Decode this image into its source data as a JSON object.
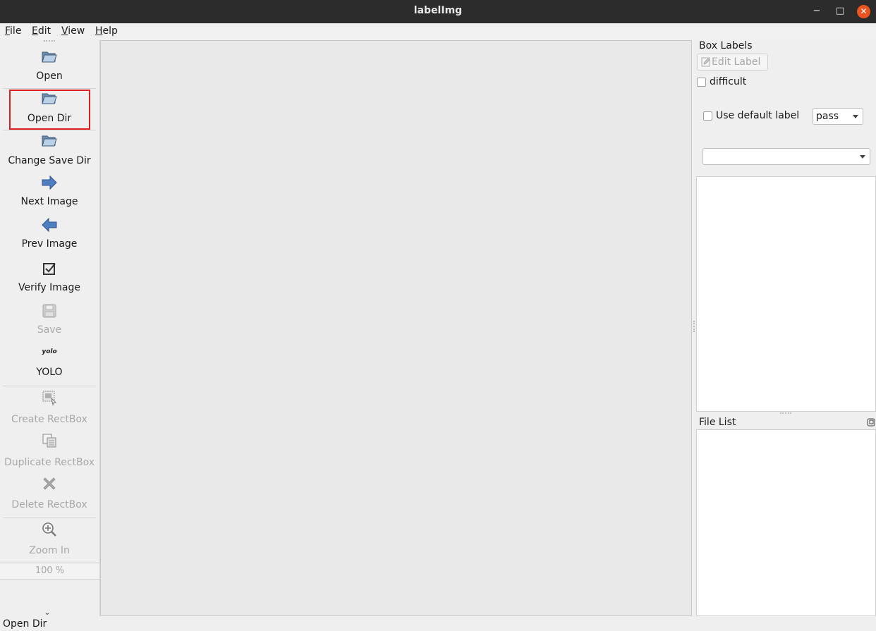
{
  "window": {
    "title": "labelImg",
    "controls": {
      "minimize": "−",
      "maximize": "□",
      "close": "✕"
    }
  },
  "menubar": {
    "items": [
      {
        "mnemonic": "F",
        "rest": "ile"
      },
      {
        "mnemonic": "E",
        "rest": "dit"
      },
      {
        "mnemonic": "V",
        "rest": "iew"
      },
      {
        "mnemonic": "H",
        "rest": "elp"
      }
    ]
  },
  "toolbar": {
    "tools": [
      {
        "label": "Open",
        "icon": "folder-open-icon",
        "enabled": true
      },
      {
        "label": "Open Dir",
        "icon": "folder-open-icon",
        "enabled": true,
        "highlighted": true
      },
      {
        "label": "Change Save Dir",
        "icon": "folder-open-icon",
        "enabled": true
      },
      {
        "label": "Next Image",
        "icon": "arrow-right-icon",
        "enabled": true
      },
      {
        "label": "Prev Image",
        "icon": "arrow-left-icon",
        "enabled": true
      },
      {
        "label": "Verify Image",
        "icon": "checkbox-check-icon",
        "enabled": true
      },
      {
        "label": "Save",
        "icon": "floppy-disk-icon",
        "enabled": false
      },
      {
        "label": "YOLO",
        "icon": "yolo-format-icon",
        "icon_text": "yolo",
        "enabled": true
      },
      {
        "label": "Create RectBox",
        "icon": "create-rect-icon",
        "enabled": false
      },
      {
        "label": "Duplicate RectBox",
        "icon": "duplicate-icon",
        "enabled": false
      },
      {
        "label": "Delete RectBox",
        "icon": "delete-x-icon",
        "enabled": false
      },
      {
        "label": "Zoom In",
        "icon": "zoom-in-icon",
        "enabled": false
      }
    ],
    "zoom_value": "100 %",
    "more_glyph": "⌄"
  },
  "box_labels": {
    "title": "Box Labels",
    "edit_label_button": "Edit Label",
    "difficult_label": "difficult",
    "use_default_label": "Use default label",
    "default_label_value": "pass",
    "label_filter_value": ""
  },
  "file_list": {
    "title": "File List"
  },
  "statusbar": {
    "message": "Open Dir"
  },
  "colors": {
    "titlebar": "#2c2c2c",
    "close_button": "#e95420",
    "highlight_box": "#e02020",
    "canvas": "#e9e9e9"
  }
}
